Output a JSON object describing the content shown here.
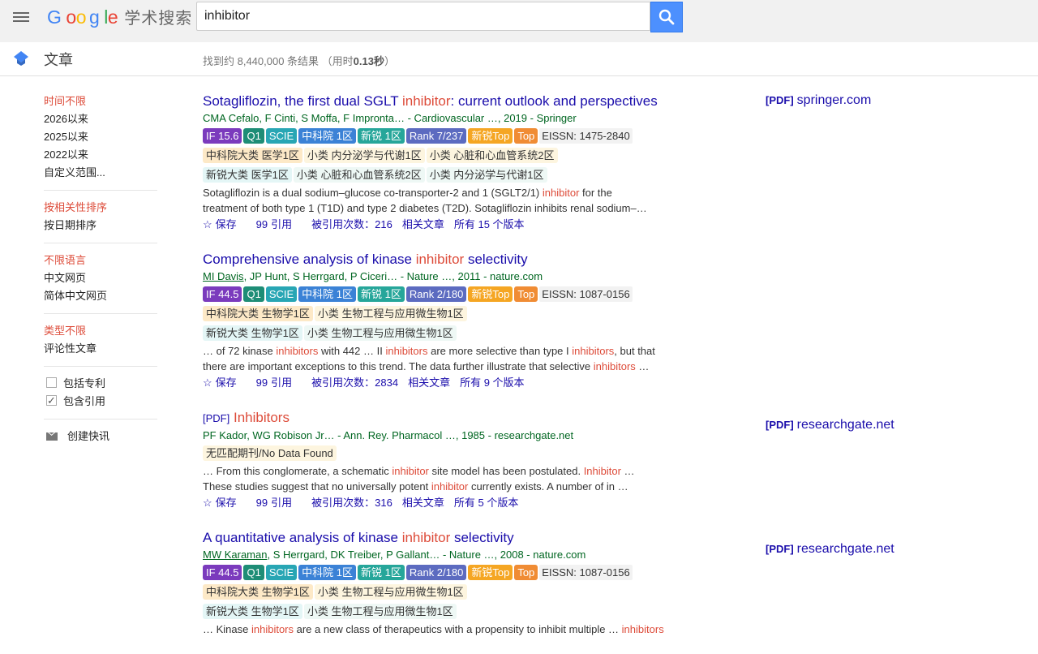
{
  "header": {
    "logo_letters": [
      "G",
      "o",
      "o",
      "g",
      "l",
      "e"
    ],
    "logo_sub": "学术搜索",
    "search_value": "inhibitor",
    "articles_label": "文章",
    "stats_prefix": "找到约 8,440,000 条结果 （用时",
    "stats_time": "0.13秒",
    "stats_suffix": "）"
  },
  "sidebar": {
    "time": [
      "时间不限",
      "2026以来",
      "2025以来",
      "2022以来",
      "自定义范围..."
    ],
    "sort": [
      "按相关性排序",
      "按日期排序"
    ],
    "lang": [
      "不限语言",
      "中文网页",
      "简体中文网页"
    ],
    "type": [
      "类型不限",
      "评论性文章"
    ],
    "include_patents": "包括专利",
    "include_citations": "包含引用",
    "create_alert": "创建快讯"
  },
  "results": [
    {
      "title_pre": "Sotagliflozin, the first dual SGLT ",
      "title_hl": "inhibitor",
      "title_post": ": current outlook and perspectives",
      "authors_u": "",
      "authors": "CMA Cefalo, F Cinti, S Moffa, F Impronta… - Cardiovascular …, 2019 - Springer",
      "badges": {
        "if": "IF 15.6",
        "q": "Q1",
        "scie": "SCIE",
        "zk": "中科院 1区",
        "xr": "新锐 1区",
        "rank": "Rank 7/237",
        "xt": "新锐Top",
        "top": "Top",
        "eissn": "EISSN: 1475-2840"
      },
      "cls1": [
        "中科院大类 医学1区",
        "小类 内分泌学与代谢1区",
        "小类 心脏和心血管系统2区"
      ],
      "cls2": [
        "新锐大类 医学1区",
        "小类 心脏和心血管系统2区",
        "小类 内分泌学与代谢1区"
      ],
      "snip1_a": "Sotagliflozin is a dual sodium–glucose co-transporter-2 and 1 (SGLT2/1) ",
      "snip1_h": "inhibitor",
      "snip1_b": " for the",
      "snip2": "treatment of both type 1 (T1D) and type 2 diabetes (T2D). Sotagliflozin inhibits renal sodium–…",
      "acts": {
        "save": "保存",
        "cite": "引用",
        "cited": "被引用次数：216",
        "related": "相关文章",
        "versions": "所有 15 个版本"
      },
      "side_tag": "[PDF]",
      "side_domain": "springer.com"
    },
    {
      "title_pre": "Comprehensive analysis of kinase ",
      "title_hl": "inhibitor",
      "title_post": " selectivity",
      "authors_u": "MI Davis",
      "authors": ", JP Hunt, S Herrgard, P Ciceri… - Nature …, 2011 - nature.com",
      "badges": {
        "if": "IF 44.5",
        "q": "Q1",
        "scie": "SCIE",
        "zk": "中科院 1区",
        "xr": "新锐 1区",
        "rank": "Rank 2/180",
        "xt": "新锐Top",
        "top": "Top",
        "eissn": "EISSN: 1087-0156"
      },
      "cls1": [
        "中科院大类 生物学1区",
        "小类 生物工程与应用微生物1区"
      ],
      "cls2": [
        "新锐大类 生物学1区",
        "小类 生物工程与应用微生物1区"
      ],
      "s1": [
        "… of 72 kinase ",
        "inhibitors",
        " with 442 … II ",
        "inhibitors",
        " are more selective than type I ",
        "inhibitors",
        ", but that"
      ],
      "s2": [
        "there are important exceptions to this trend. The data further illustrate that selective ",
        "inhibitors",
        " …"
      ],
      "acts": {
        "save": "保存",
        "cite": "引用",
        "cited": "被引用次数：2834",
        "related": "相关文章",
        "versions": "所有 9 个版本"
      }
    },
    {
      "pdf_tag": "[PDF]",
      "title": "Inhibitors",
      "authors": "PF Kador, WG Robison Jr… - Ann. Rey. Pharmacol …, 1985 - researchgate.net",
      "nodata": "无匹配期刊/No Data Found",
      "s1": [
        "… From this conglomerate, a schematic ",
        "inhibitor",
        " site model has been postulated. ",
        "Inhibitor",
        " …"
      ],
      "s2": [
        "These studies suggest that no universally potent ",
        "inhibitor",
        " currently exists. A number of in …"
      ],
      "acts": {
        "save": "保存",
        "cite": "引用",
        "cited": "被引用次数：316",
        "related": "相关文章",
        "versions": "所有 5 个版本"
      },
      "side_tag": "[PDF]",
      "side_domain": "researchgate.net"
    },
    {
      "title_pre": "A quantitative analysis of kinase ",
      "title_hl": "inhibitor",
      "title_post": " selectivity",
      "authors_u": "MW Karaman",
      "authors": ", S Herrgard, DK Treiber, P Gallant… - Nature …, 2008 - nature.com",
      "badges": {
        "if": "IF 44.5",
        "q": "Q1",
        "scie": "SCIE",
        "zk": "中科院 1区",
        "xr": "新锐 1区",
        "rank": "Rank 2/180",
        "xt": "新锐Top",
        "top": "Top",
        "eissn": "EISSN: 1087-0156"
      },
      "cls1": [
        "中科院大类 生物学1区",
        "小类 生物工程与应用微生物1区"
      ],
      "cls2": [
        "新锐大类 生物学1区",
        "小类 生物工程与应用微生物1区"
      ],
      "s1": [
        "… Kinase ",
        "inhibitors",
        " are a new class of therapeutics with a propensity to inhibit multiple … ",
        "inhibitors"
      ],
      "side_tag": "[PDF]",
      "side_domain": "researchgate.net"
    }
  ]
}
